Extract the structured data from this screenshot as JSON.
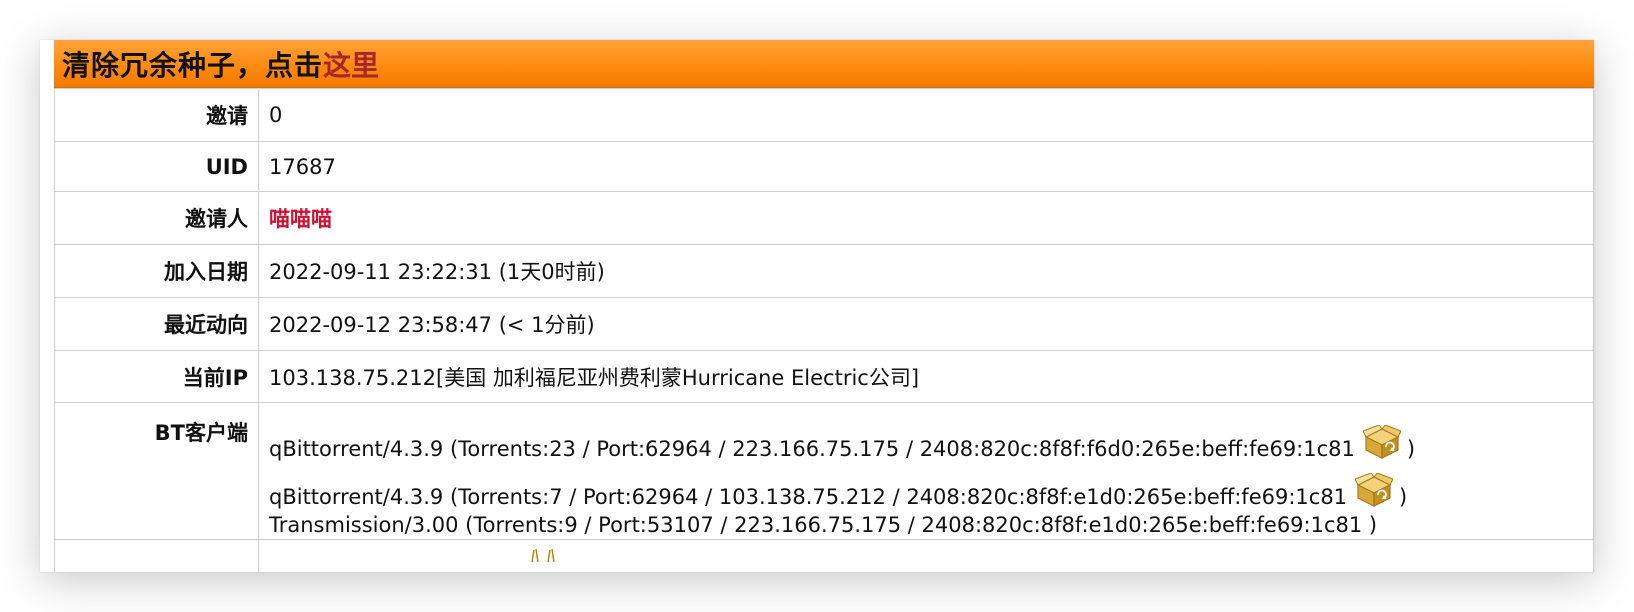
{
  "banner": {
    "text": "清除冗余种子，点击",
    "link_text": "这里"
  },
  "rows": [
    {
      "label": "邀请",
      "value": "0"
    },
    {
      "label": "UID",
      "value": "17687"
    },
    {
      "label": "邀请人",
      "value": "喵喵喵"
    },
    {
      "label": "加入日期",
      "value": "2022-09-11 23:22:31 (1天0时前)"
    },
    {
      "label": "最近动向",
      "value": "2022-09-12 23:58:47 (< 1分前)"
    },
    {
      "label": "当前IP",
      "value": "103.138.75.212[美国 加利福尼亚州费利蒙Hurricane Electric公司]"
    }
  ],
  "bt_clients": {
    "label": "BT客户端",
    "clients": [
      {
        "text": "qBittorrent/4.3.9 (Torrents:23 / Port:62964 / 223.166.75.175 / 2408:820c:8f8f:f6d0:265e:beff:fe69:1c81",
        "close": ")",
        "icon": "recycle-box-icon"
      },
      {
        "text": "qBittorrent/4.3.9 (Torrents:7 / Port:62964 / 103.138.75.212 / 2408:820c:8f8f:e1d0:265e:beff:fe69:1c81",
        "close": ")",
        "icon": "recycle-box-icon"
      },
      {
        "text": "Transmission/3.00 (Torrents:9 / Port:53107 / 223.166.75.175 / 2408:820c:8f8f:e1d0:265e:beff:fe69:1c81 )"
      }
    ]
  },
  "colors": {
    "banner_orange": "#ff8a10",
    "link_red": "#a6262a",
    "inviter_red": "#cc1133",
    "border": "#cfcfcf"
  }
}
